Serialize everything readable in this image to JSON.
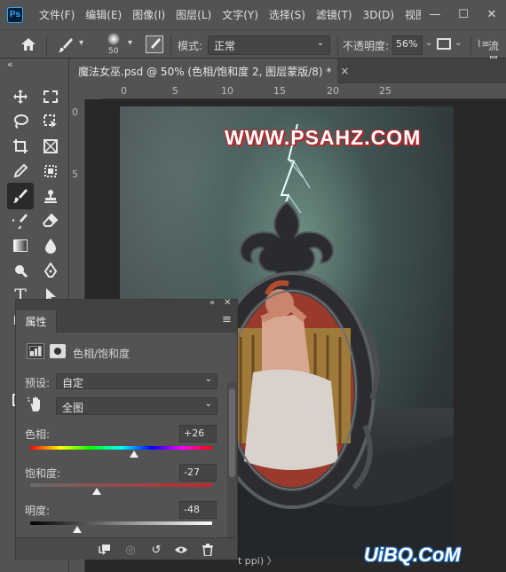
{
  "menubar": {
    "logo": "Ps",
    "items": [
      "文件(F)",
      "编辑(E)",
      "图像(I)",
      "图层(L)",
      "文字(Y)",
      "选择(S)",
      "滤镜(T)",
      "3D(D)",
      "视图("
    ],
    "win_min": "—",
    "win_max": "☐",
    "win_close": "✕"
  },
  "options": {
    "brush_size": "50",
    "mode_label": "模式:",
    "mode_value": "正常",
    "opacity_label": "不透明度:",
    "opacity_value": "56%",
    "flow_label": "流量"
  },
  "tab": {
    "title": "魔法女巫.psd @ 50% (色相/饱和度 2, 图层蒙版/8) *",
    "close": "×",
    "collapse": "«"
  },
  "rulers": {
    "h": [
      "0",
      "5",
      "10",
      "15",
      "20",
      "25"
    ],
    "v": [
      "0",
      "5"
    ]
  },
  "canvas": {
    "watermark": "WWW.PSAHZ.COM"
  },
  "properties": {
    "collapse": "«",
    "tab_label": "属性",
    "menu_icon": "≡",
    "adjustment_title": "色相/饱和度",
    "preset_label": "预设:",
    "preset_value": "自定",
    "channel_value": "全图",
    "hue_label": "色相:",
    "hue_value": "+26",
    "saturation_label": "饱和度:",
    "saturation_value": "-27",
    "lightness_label": "明度:",
    "lightness_value": "-48",
    "hue_level": 26,
    "saturation_level": -27,
    "lightness_level": -48
  },
  "status": {
    "text": "t ppi) 〉"
  },
  "corner_watermark": "UiBQ.CoM",
  "colors": {
    "panel": "#535353",
    "dark": "#424242",
    "accent": "#31a8ff",
    "watermark_outline": "#b4272b"
  }
}
